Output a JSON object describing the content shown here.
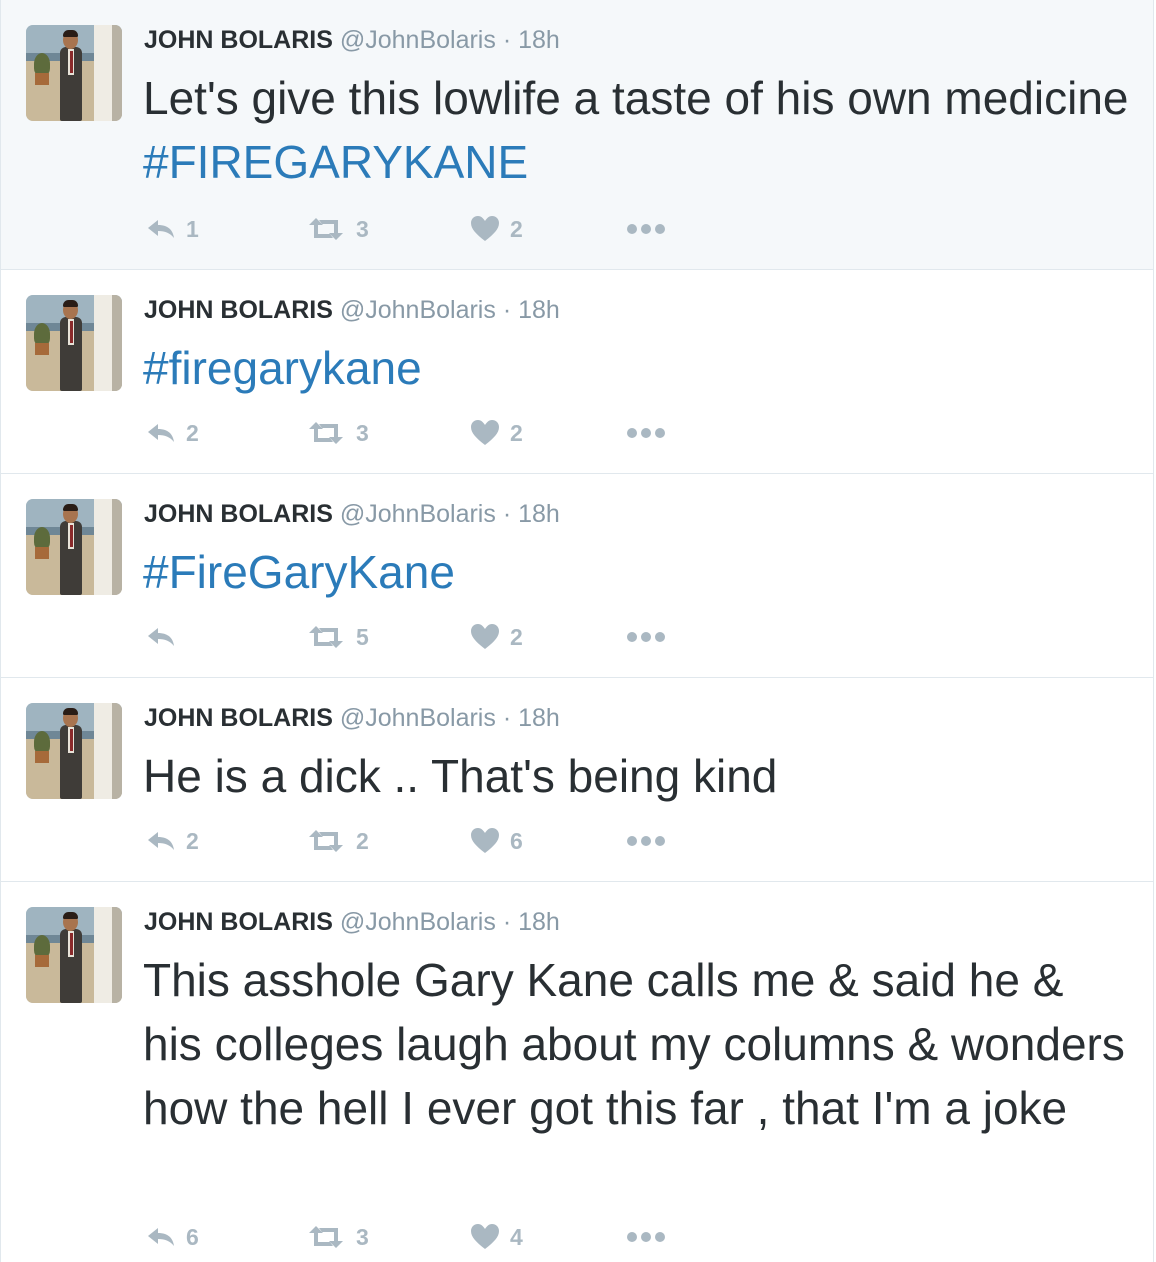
{
  "colors": {
    "link": "#2b7bb9",
    "text": "#292f33",
    "meta": "#8899a6",
    "action": "#aab8c2",
    "border": "#e1e8ed",
    "highlight_bg": "#f5f8fa"
  },
  "icons": {
    "reply": "reply-icon",
    "retweet": "retweet-icon",
    "like": "heart-icon",
    "more": "more-dots-icon"
  },
  "tweets": [
    {
      "name": "JOHN BOLARIS",
      "handle": "@JohnBolaris",
      "separator": "·",
      "time": "18h",
      "text_plain": "Let's give this lowlife a taste of his own medicine",
      "hashtag": "#FIREGARYKANE",
      "reply_count": "1",
      "retweet_count": "3",
      "like_count": "2"
    },
    {
      "name": "JOHN BOLARIS",
      "handle": "@JohnBolaris",
      "separator": "·",
      "time": "18h",
      "text_plain": "",
      "hashtag": "#firegarykane",
      "reply_count": "2",
      "retweet_count": "3",
      "like_count": "2"
    },
    {
      "name": "JOHN BOLARIS",
      "handle": "@JohnBolaris",
      "separator": "·",
      "time": "18h",
      "text_plain": "",
      "hashtag": "#FireGaryKane",
      "reply_count": "",
      "retweet_count": "5",
      "like_count": "2"
    },
    {
      "name": "JOHN BOLARIS",
      "handle": "@JohnBolaris",
      "separator": "·",
      "time": "18h",
      "text_plain": "He is a dick .. That's being kind",
      "hashtag": "",
      "reply_count": "2",
      "retweet_count": "2",
      "like_count": "6"
    },
    {
      "name": "JOHN BOLARIS",
      "handle": "@JohnBolaris",
      "separator": "·",
      "time": "18h",
      "text_plain": "This asshole Gary Kane calls me & said he & his colleges laugh about my columns & wonders how the hell I ever got this far , that I'm a joke",
      "hashtag": "",
      "reply_count": "6",
      "retweet_count": "3",
      "like_count": "4"
    }
  ]
}
